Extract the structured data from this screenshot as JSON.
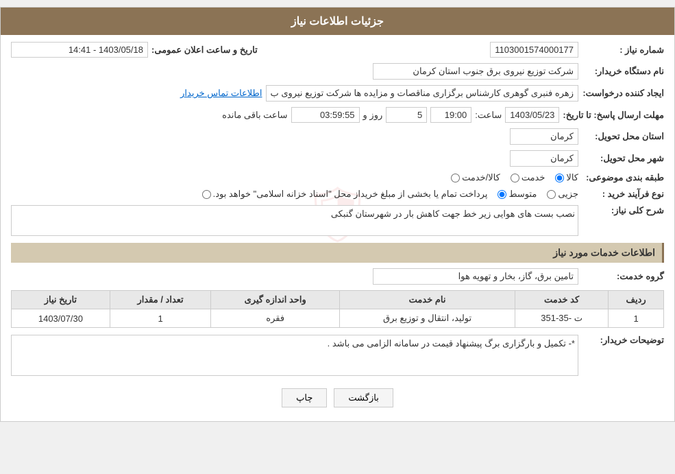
{
  "header": {
    "title": "جزئیات اطلاعات نیاز"
  },
  "fields": {
    "shomara_niaz_label": "شماره نیاز :",
    "shomara_niaz_value": "1103001574000177",
    "nam_dastgah_label": "نام دستگاه خریدار:",
    "nam_dastgah_value": "شرکت توزیع نیروی برق جنوب استان کرمان",
    "tarikh_label": "تاریخ و ساعت اعلان عمومی:",
    "tarikh_value": "1403/05/18 - 14:41",
    "ijad_label": "ایجاد کننده درخواست:",
    "ijad_value": "زهره فنبری گوهری کارشناس برگزاری مناقصات و مزایده ها شرکت توزیع نیروی ب",
    "ijad_link": "اطلاعات تماس خریدار",
    "mohlat_label": "مهلت ارسال پاسخ: تا تاریخ:",
    "mohlat_date": "1403/05/23",
    "mohlat_saat_label": "ساعت:",
    "mohlat_saat": "19:00",
    "mohlat_rooz_label": "روز و",
    "mohlat_rooz": "5",
    "mohlat_baghimande_label": "ساعت باقی مانده",
    "mohlat_baghimande": "03:59:55",
    "ostan_label": "استان محل تحویل:",
    "ostan_value": "کرمان",
    "shahr_label": "شهر محل تحویل:",
    "shahr_value": "کرمان",
    "tabaqe_label": "طبقه بندی موضوعی:",
    "tabaqe_options": [
      {
        "label": "کالا",
        "selected": true
      },
      {
        "label": "خدمت",
        "selected": false
      },
      {
        "label": "کالا/خدمت",
        "selected": false
      }
    ],
    "noe_label": "نوع فرآیند خرید :",
    "noe_options": [
      {
        "label": "جزیی",
        "selected": false
      },
      {
        "label": "متوسط",
        "selected": true
      },
      {
        "label": "پرداخت تمام یا بخشی از مبلغ خریداز محل \"اسناد خزانه اسلامی\" خواهد بود.",
        "selected": false
      }
    ],
    "sharh_label": "شرح کلی نیاز:",
    "sharh_value": "نصب بست های هوایی زیر خط جهت کاهش بار در شهرستان گنبکی",
    "section2_title": "اطلاعات خدمات مورد نیاز",
    "grooh_label": "گروه خدمت:",
    "grooh_value": "تامین برق، گاز، بخار و تهویه هوا",
    "table": {
      "headers": [
        "ردیف",
        "کد خدمت",
        "نام خدمت",
        "واحد اندازه گیری",
        "تعداد / مقدار",
        "تاریخ نیاز"
      ],
      "rows": [
        {
          "radif": "1",
          "kod": "ت -35-351",
          "nam": "تولید، انتقال و توزیع برق",
          "vahed": "فقره",
          "tedad": "1",
          "tarikh": "1403/07/30"
        }
      ]
    },
    "tosihaat_label": "توضیحات خریدار:",
    "tosihaat_value": "*- تکمیل و بارگزاری برگ پیشنهاد قیمت در سامانه الزامی می باشد .",
    "btn_chap": "چاپ",
    "btn_bazgasht": "بازگشت"
  }
}
